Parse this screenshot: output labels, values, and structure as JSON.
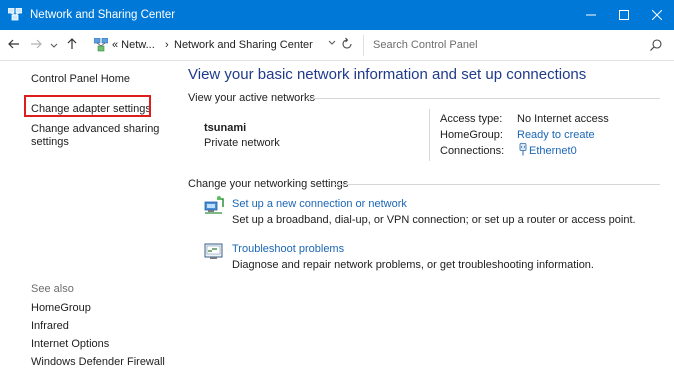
{
  "window": {
    "title": "Network and Sharing Center",
    "controls": {
      "minimize": "minimize-icon",
      "maximize": "maximize-icon",
      "close": "close-icon"
    }
  },
  "address": {
    "back_icon": "back-arrow-icon",
    "forward_icon": "forward-arrow-icon",
    "recent_icon": "chevron-down-icon",
    "up_icon": "up-arrow-icon",
    "crumb_prefix": "« Netw...",
    "crumb_sep": "›",
    "crumb_current": "Network and Sharing Center",
    "search_placeholder": "Search Control Panel"
  },
  "sidebar": {
    "home": "Control Panel Home",
    "items": [
      {
        "label": "Change adapter settings",
        "highlighted": true
      },
      {
        "label": "Change advanced sharing settings",
        "highlighted": false
      }
    ],
    "see_also_label": "See also",
    "see_also": [
      "HomeGroup",
      "Infrared",
      "Internet Options",
      "Windows Defender Firewall"
    ]
  },
  "main": {
    "heading": "View your basic network information and set up connections",
    "active_section": "View your active networks",
    "network": {
      "name": "tsunami",
      "type": "Private network",
      "access_type_label": "Access type:",
      "access_type_value": "No Internet access",
      "homegroup_label": "HomeGroup:",
      "homegroup_value": "Ready to create",
      "connections_label": "Connections:",
      "connections_value": "Ethernet0"
    },
    "settings_section": "Change your networking settings",
    "tasks": [
      {
        "link": "Set up a new connection or network",
        "desc": "Set up a broadband, dial-up, or VPN connection; or set up a router or access point.",
        "icon": "new-connection-icon"
      },
      {
        "link": "Troubleshoot problems",
        "desc": "Diagnose and repair network problems, or get troubleshooting information.",
        "icon": "troubleshoot-icon"
      }
    ]
  },
  "colors": {
    "titlebar": "#0078d7",
    "link": "#1c66b5",
    "heading": "#1f3b8c",
    "highlight_border": "#e01d1d"
  }
}
